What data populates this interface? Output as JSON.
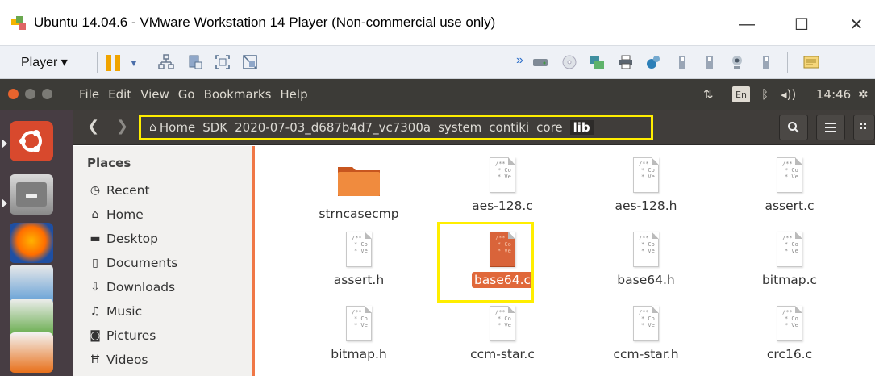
{
  "vmware": {
    "title": "Ubuntu 14.04.6 - VMware Workstation 14 Player (Non-commercial use only)",
    "minimize": "—",
    "maximize": "☐",
    "close": "✕",
    "player_menu": "Player ▾"
  },
  "ubuntu_panel": {
    "menu": [
      "File",
      "Edit",
      "View",
      "Go",
      "Bookmarks",
      "Help"
    ],
    "keyboard_layout": "En",
    "time": "14:46"
  },
  "path": [
    "Home",
    "SDK",
    "2020-07-03_d687b4d7_vc7300a",
    "system",
    "contiki",
    "core",
    "lib"
  ],
  "sidebar": {
    "heading": "Places",
    "items": [
      {
        "label": "Recent",
        "icon": "clock-icon"
      },
      {
        "label": "Home",
        "icon": "home-icon"
      },
      {
        "label": "Desktop",
        "icon": "desktop-folder-icon"
      },
      {
        "label": "Documents",
        "icon": "document-icon"
      },
      {
        "label": "Downloads",
        "icon": "download-icon"
      },
      {
        "label": "Music",
        "icon": "music-icon"
      },
      {
        "label": "Pictures",
        "icon": "camera-icon"
      },
      {
        "label": "Videos",
        "icon": "film-icon"
      }
    ]
  },
  "files": [
    {
      "name": "strncasecmp",
      "kind": "folder"
    },
    {
      "name": "aes-128.c",
      "kind": "text"
    },
    {
      "name": "aes-128.h",
      "kind": "text"
    },
    {
      "name": "assert.c",
      "kind": "text"
    },
    {
      "name": "assert.h",
      "kind": "text"
    },
    {
      "name": "base64.c",
      "kind": "text",
      "selected": true
    },
    {
      "name": "base64.h",
      "kind": "text"
    },
    {
      "name": "bitmap.c",
      "kind": "text"
    },
    {
      "name": "bitmap.h",
      "kind": "text"
    },
    {
      "name": "ccm-star.c",
      "kind": "text"
    },
    {
      "name": "ccm-star.h",
      "kind": "text"
    },
    {
      "name": "crc16.c",
      "kind": "text"
    }
  ],
  "colors": {
    "ubuntu_orange": "#f07746",
    "selection": "#e0683a",
    "annotation": "#ffee00",
    "panel_dark": "#3c3b37"
  }
}
